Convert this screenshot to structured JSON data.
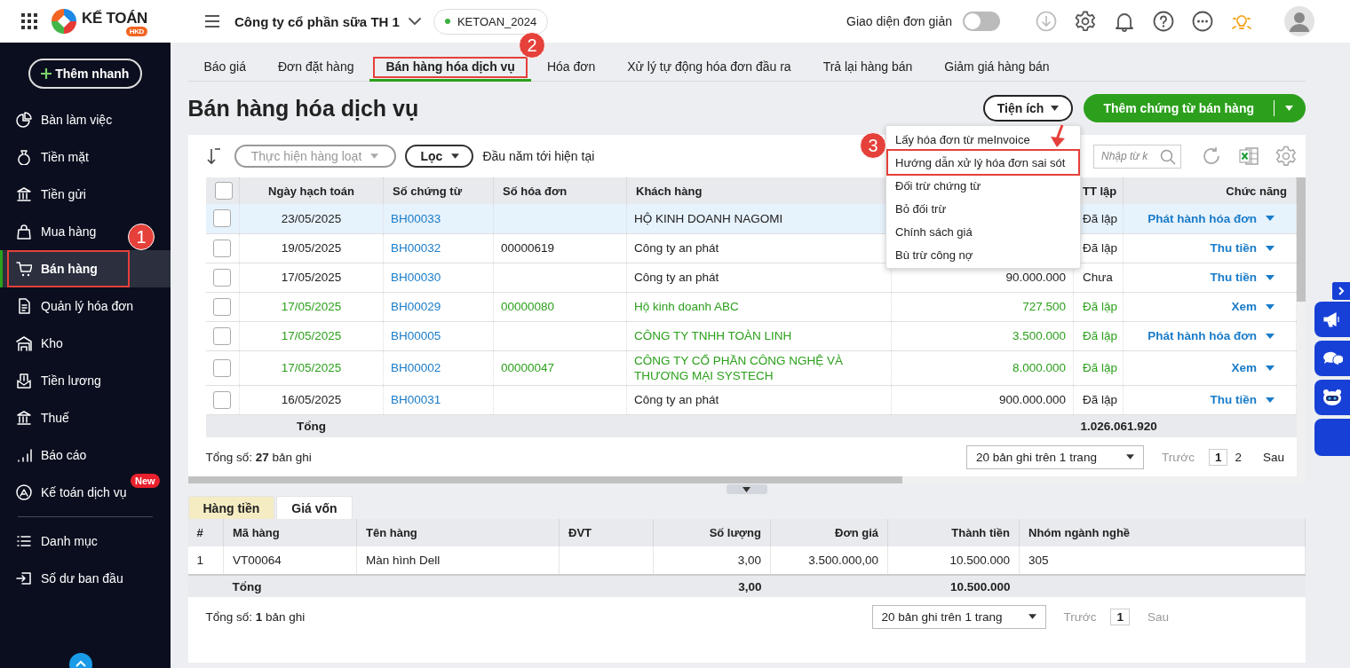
{
  "topbar": {
    "app_name": "KẾ TOÁN",
    "app_badge": "HKD",
    "company": "Công ty cổ phần sữa TH 1",
    "database": "KETOAN_2024",
    "simple_mode": {
      "label": "Giao diện đơn giản",
      "on": false
    }
  },
  "sidebar": {
    "quick_add": "Thêm nhanh",
    "groups": [
      {
        "items": [
          {
            "label": "Bàn làm việc",
            "selected": false,
            "highlighted": false
          },
          {
            "label": "Tiền mặt",
            "selected": false,
            "highlighted": false
          },
          {
            "label": "Tiền gửi",
            "selected": false,
            "highlighted": false
          },
          {
            "label": "Mua hàng",
            "selected": false,
            "highlighted": false
          },
          {
            "label": "Bán hàng",
            "selected": true,
            "highlighted": true
          },
          {
            "label": "Quản lý hóa đơn",
            "selected": false,
            "highlighted": false
          },
          {
            "label": "Kho",
            "selected": false,
            "highlighted": false
          },
          {
            "label": "Tiền lương",
            "selected": false,
            "highlighted": false
          },
          {
            "label": "Thuế",
            "selected": false,
            "highlighted": false
          },
          {
            "label": "Báo cáo",
            "selected": false,
            "highlighted": false
          },
          {
            "label": "Kế toán dịch vụ",
            "selected": false,
            "highlighted": false,
            "badge": "New"
          }
        ]
      },
      {
        "items": [
          {
            "label": "Danh mục",
            "selected": false,
            "highlighted": false
          },
          {
            "label": "Số dư ban đầu",
            "selected": false,
            "highlighted": false
          }
        ]
      }
    ]
  },
  "tabs": [
    {
      "label": "Báo giá",
      "selected": false,
      "highlighted": false
    },
    {
      "label": "Đơn đặt hàng",
      "selected": false,
      "highlighted": false
    },
    {
      "label": "Bán hàng hóa dịch vụ",
      "selected": true,
      "highlighted": true
    },
    {
      "label": "Hóa đơn",
      "selected": false,
      "highlighted": false
    },
    {
      "label": "Xử lý tự động hóa đơn đầu ra",
      "selected": false,
      "highlighted": false
    },
    {
      "label": "Trả lại hàng bán",
      "selected": false,
      "highlighted": false
    },
    {
      "label": "Giảm giá hàng bán",
      "selected": false,
      "highlighted": false
    }
  ],
  "page_title": "Bán hàng hóa dịch vụ",
  "utilities_button": "Tiện ích",
  "add_button": "Thêm chứng từ bán hàng",
  "utilities_menu": [
    {
      "label": "Lấy hóa đơn từ meInvoice",
      "highlighted": false
    },
    {
      "label": "Hướng dẫn xử lý hóa đơn sai sót",
      "highlighted": true
    },
    {
      "label": "Đối trừ chứng từ",
      "highlighted": false
    },
    {
      "label": "Bỏ đối trừ",
      "highlighted": false
    },
    {
      "label": "Chính sách giá",
      "highlighted": false
    },
    {
      "label": "Bù trừ công nợ",
      "highlighted": false
    }
  ],
  "toolbar": {
    "bulk_action": {
      "label": "Thực hiện hàng loạt",
      "disabled": true
    },
    "filter": "Lọc",
    "period": "Đầu năm tới hiện tại",
    "search": {
      "placeholder": "Nhập từ k"
    }
  },
  "table": {
    "header_checked": false,
    "columns": [
      {
        "label": "Ngày hạch toán"
      },
      {
        "label": "Số chứng từ"
      },
      {
        "label": "Số hóa đơn"
      },
      {
        "label": "Khách hàng"
      },
      {},
      {
        "label": "TT lập"
      },
      {
        "label": "Chức năng"
      }
    ],
    "rows": [
      {
        "checked": false,
        "selected": true,
        "color": "#222222",
        "date": "23/05/2025",
        "voucher": "BH00033",
        "customer": "HỘ KINH DOANH NAGOMI",
        "status": "Đã lập",
        "action": "Phát hành hóa đơn"
      },
      {
        "checked": false,
        "selected": false,
        "color": "#222222",
        "date": "19/05/2025",
        "voucher": "BH00032",
        "invoice": "00000619",
        "customer": "Công ty an phát",
        "status": "Đã lập",
        "action": "Thu tiền"
      },
      {
        "checked": false,
        "selected": false,
        "color": "#222222",
        "date": "17/05/2025",
        "voucher": "BH00030",
        "customer": "Công ty an phát",
        "amount": "90.000.000",
        "status": "Chưa",
        "action": "Thu tiền"
      },
      {
        "checked": false,
        "selected": false,
        "color": "#2ca01c",
        "date": "17/05/2025",
        "voucher": "BH00029",
        "invoice": "00000080",
        "customer": "Hộ kinh doanh ABC",
        "amount": "727.500",
        "status": "Đã lập",
        "action": "Xem"
      },
      {
        "checked": false,
        "selected": false,
        "color": "#2ca01c",
        "date": "17/05/2025",
        "voucher": "BH00005",
        "customer": "CÔNG TY TNHH TOÀN LINH",
        "amount": "3.500.000",
        "status": "Đã lập",
        "action": "Phát hành hóa đơn"
      },
      {
        "checked": false,
        "selected": false,
        "color": "#2ca01c",
        "date": "17/05/2025",
        "voucher": "BH00002",
        "invoice": "00000047",
        "customer": "CÔNG TY CỔ PHẦN CÔNG NGHỆ VÀ THƯƠNG MẠI SYSTECH",
        "amount": "8.000.000",
        "status": "Đã lập",
        "action": "Xem"
      },
      {
        "checked": false,
        "selected": false,
        "color": "#222222",
        "date": "16/05/2025",
        "voucher": "BH00031",
        "customer": "Công ty an phát",
        "amount": "900.000.000",
        "status": "Đã lập",
        "action": "Thu tiền"
      }
    ],
    "total_label": "Tổng",
    "total_amount": "1.026.061.920",
    "record_count": "Tổng số: **27** bản ghi",
    "pager": {
      "page_size": "20 bản ghi trên 1 trang",
      "prev": "Trước",
      "prev_disabled": true,
      "pages": [
        {
          "label": "1",
          "selected": true
        },
        {
          "label": "2",
          "selected": false
        }
      ],
      "next": "Sau",
      "next_disabled": false
    }
  },
  "detail": {
    "tabs": [
      {
        "label": "Hàng tiền",
        "selected": true
      },
      {
        "label": "Giá vốn",
        "selected": false
      }
    ],
    "columns": [
      "#",
      "Mã hàng",
      "Tên hàng",
      "ĐVT",
      "Số lượng",
      "Đơn giá",
      "Thành tiền",
      "Nhóm ngành nghề"
    ],
    "rows": [
      {
        "index": "1",
        "code": "VT00064",
        "name": "Màn hình Dell",
        "quantity": "3,00",
        "unit_price": "3.500.000,00",
        "amount": "10.500.000",
        "group": "305"
      }
    ],
    "total": {
      "label": "Tổng",
      "quantity": "3,00",
      "amount": "10.500.000"
    },
    "record_count": "Tổng số: **1** bản ghi",
    "pager": {
      "page_size": "20 bản ghi trên 1 trang",
      "prev": "Trước",
      "prev_disabled": true,
      "pages": [
        {
          "label": "1",
          "selected": true
        }
      ],
      "next": "Sau",
      "next_disabled": true
    }
  },
  "annotations": [
    {
      "label": "1"
    },
    {
      "label": "2"
    },
    {
      "label": "3"
    }
  ]
}
